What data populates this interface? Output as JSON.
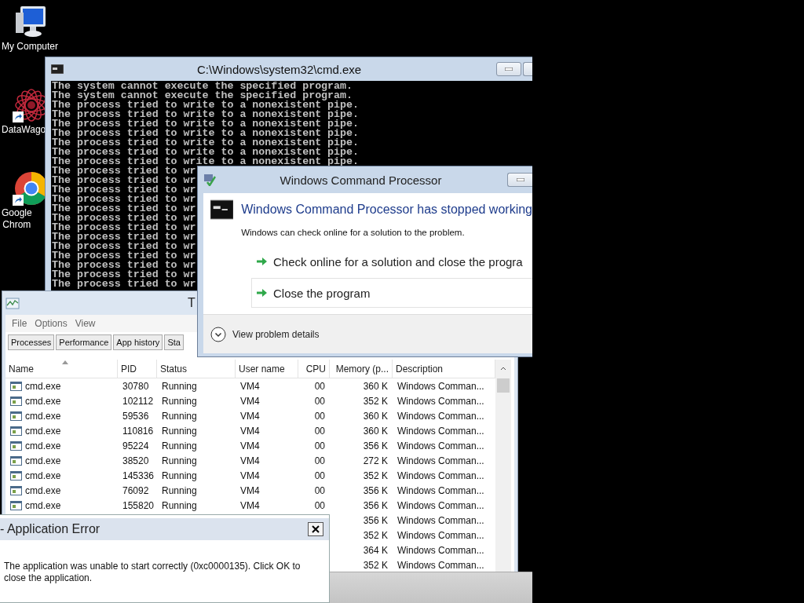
{
  "desktop_icons": [
    {
      "kind": "computer",
      "label": [
        "My Computer"
      ],
      "shortcut": false
    },
    {
      "kind": "mandala",
      "label": [
        "DataWago"
      ],
      "shortcut": true
    },
    {
      "kind": "chrome",
      "label": [
        "Google",
        "Chrom"
      ],
      "shortcut": true
    }
  ],
  "cmd_window": {
    "title": "C:\\Windows\\system32\\cmd.exe",
    "lines": [
      "The system cannot execute the specified program.",
      "The system cannot execute the specified program.",
      "The process tried to write to a nonexistent pipe.",
      "The process tried to write to a nonexistent pipe.",
      "The process tried to write to a nonexistent pipe.",
      "The process tried to write to a nonexistent pipe.",
      "The process tried to write to a nonexistent pipe.",
      "The process tried to write to a nonexistent pipe.",
      "The process tried to write to a nonexistent pipe.",
      "The process tried to wr",
      "The process tried to wr",
      "The process tried to wr",
      "The process tried to wr",
      "The process tried to wr",
      "The process tried to wr",
      "The process tried to wr",
      "The process tried to wr",
      "The process tried to wr",
      "The process tried to wr",
      "The process tried to wr",
      "The process tried to wr",
      "The process tried to wr"
    ]
  },
  "task_manager": {
    "title": "T",
    "menu": [
      "File",
      "Options",
      "View"
    ],
    "tabs": [
      "Processes",
      "Performance",
      "App history",
      "Sta"
    ],
    "columns": [
      "Name",
      "PID",
      "Status",
      "User name",
      "CPU",
      "Memory (p...",
      "Description"
    ],
    "rows": [
      {
        "name": "cmd.exe",
        "pid": "30780",
        "status": "Running",
        "user": "VM4",
        "cpu": "00",
        "memory": "360 K",
        "description": "Windows Comman..."
      },
      {
        "name": "cmd.exe",
        "pid": "102112",
        "status": "Running",
        "user": "VM4",
        "cpu": "00",
        "memory": "352 K",
        "description": "Windows Comman..."
      },
      {
        "name": "cmd.exe",
        "pid": "59536",
        "status": "Running",
        "user": "VM4",
        "cpu": "00",
        "memory": "360 K",
        "description": "Windows Comman..."
      },
      {
        "name": "cmd.exe",
        "pid": "110816",
        "status": "Running",
        "user": "VM4",
        "cpu": "00",
        "memory": "360 K",
        "description": "Windows Comman..."
      },
      {
        "name": "cmd.exe",
        "pid": "95224",
        "status": "Running",
        "user": "VM4",
        "cpu": "00",
        "memory": "356 K",
        "description": "Windows Comman..."
      },
      {
        "name": "cmd.exe",
        "pid": "38520",
        "status": "Running",
        "user": "VM4",
        "cpu": "00",
        "memory": "272 K",
        "description": "Windows Comman..."
      },
      {
        "name": "cmd.exe",
        "pid": "145336",
        "status": "Running",
        "user": "VM4",
        "cpu": "00",
        "memory": "352 K",
        "description": "Windows Comman..."
      },
      {
        "name": "cmd.exe",
        "pid": "76092",
        "status": "Running",
        "user": "VM4",
        "cpu": "00",
        "memory": "356 K",
        "description": "Windows Comman..."
      },
      {
        "name": "cmd.exe",
        "pid": "155820",
        "status": "Running",
        "user": "VM4",
        "cpu": "00",
        "memory": "356 K",
        "description": "Windows Comman..."
      },
      {
        "memory": "356 K",
        "description": "Windows Comman..."
      },
      {
        "memory": "352 K",
        "description": "Windows Comman..."
      },
      {
        "memory": "364 K",
        "description": "Windows Comman..."
      },
      {
        "memory": "352 K",
        "description": "Windows Comman..."
      }
    ]
  },
  "crash_dialog": {
    "title": "Windows Command Processor",
    "heading": "Windows Command Processor has stopped working",
    "message": "Windows can check online for a solution to the problem.",
    "options": [
      {
        "label": "Check online for a solution and close the progra",
        "selected": false
      },
      {
        "label": "Close the program",
        "selected": true
      }
    ],
    "details": "View problem details"
  },
  "app_error": {
    "title": "- Application Error",
    "message": "The application was unable to start correctly (0xc0000135). Click OK to close the application."
  }
}
